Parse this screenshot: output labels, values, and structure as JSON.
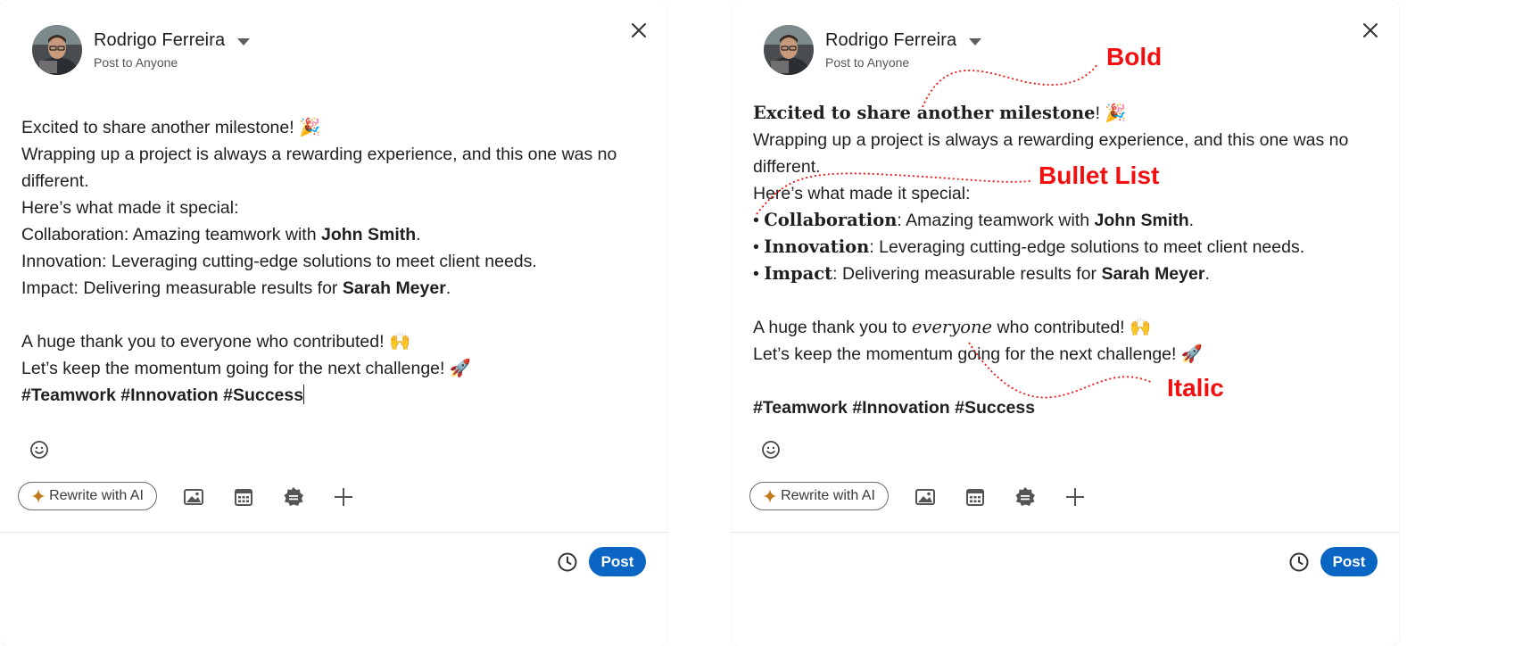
{
  "colors": {
    "accent": "#0a66c2",
    "annotation": "#f20f0f"
  },
  "left": {
    "author": {
      "name": "Rodrigo Ferreira",
      "audience": "Post to Anyone"
    },
    "editor": {
      "line1": "Excited to share another milestone! ",
      "line1_emoji": "🎉",
      "line2": "Wrapping up a project is always a rewarding experience, and this one was no different.",
      "line3": "Here’s what made it special:",
      "collab_label": "Collaboration",
      "collab_text": ": Amazing teamwork with ",
      "collab_person": "John Smith",
      "innov_label": "Innovation",
      "innov_text": ": Leveraging cutting-edge solutions to meet client needs.",
      "impact_label": "Impact",
      "impact_text": ": Delivering measurable results for ",
      "impact_person": "Sarah Meyer",
      "period": ".",
      "thanks_pre": "A huge thank you to ",
      "thanks_word": "everyone",
      "thanks_post": " who contributed! ",
      "thanks_emoji": "🙌",
      "momentum": "Let’s keep the momentum going for the next challenge! ",
      "momentum_emoji": "🚀",
      "hashtags": "#Teamwork #Innovation #Success"
    },
    "toolbar": {
      "rewrite_label": "Rewrite with AI"
    },
    "post_label": "Post"
  },
  "right": {
    "author": {
      "name": "Rodrigo Ferreira",
      "audience": "Post to Anyone"
    },
    "editor": {
      "line1_bold": "Excited to share another milestone",
      "line1_rest": "! ",
      "line1_emoji": "🎉",
      "line2": "Wrapping up a project is always a rewarding experience, and this one was no different.",
      "line3": "Here’s what made it special:",
      "bullet": "• ",
      "collab_label": "Collaboration",
      "collab_text": ": Amazing teamwork with ",
      "collab_person": "John Smith",
      "innov_label": "Innovation",
      "innov_text": ": Leveraging cutting-edge solutions to meet client needs.",
      "impact_label": "Impact",
      "impact_text": ": Delivering measurable results for ",
      "impact_person": "Sarah Meyer",
      "period": ".",
      "thanks_pre": "A huge thank you to ",
      "thanks_word": "everyone",
      "thanks_post": " who contributed! ",
      "thanks_emoji": "🙌",
      "momentum": "Let’s keep the momentum going for the next challenge! ",
      "momentum_emoji": "🚀",
      "hashtags": "#Teamwork #Innovation #Success"
    },
    "toolbar": {
      "rewrite_label": "Rewrite with AI"
    },
    "post_label": "Post"
  },
  "annotations": {
    "bold": "Bold",
    "bullet_list": "Bullet List",
    "italic": "Italic"
  }
}
